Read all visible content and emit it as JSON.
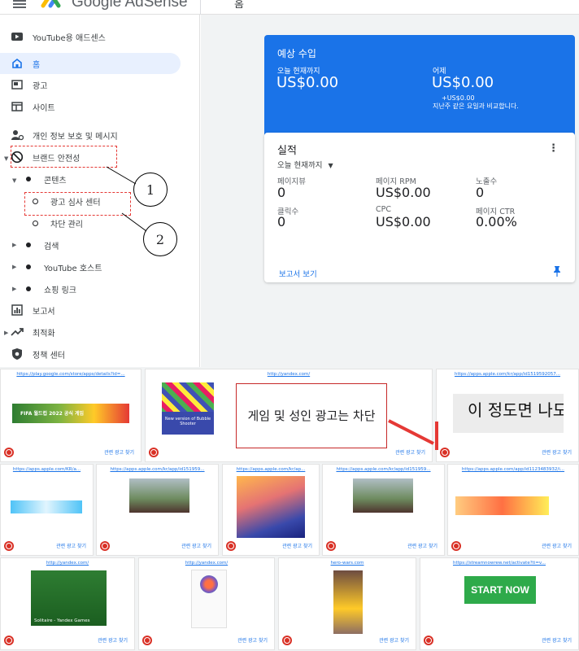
{
  "header": {
    "brand": "Google AdSense",
    "page_title": "홈"
  },
  "sidebar": {
    "items": [
      {
        "label": "YouTube용 애드센스",
        "icon": "youtube-icon"
      },
      {
        "label": "홈",
        "icon": "home-icon",
        "active": true
      },
      {
        "label": "광고",
        "icon": "ads-icon"
      },
      {
        "label": "사이트",
        "icon": "sites-icon"
      },
      {
        "label": "개인 정보 보호 및 메시지",
        "icon": "privacy-icon"
      },
      {
        "label": "브랜드 안전성",
        "icon": "block-icon"
      },
      {
        "label": "콘텐츠",
        "icon": "dot-icon"
      },
      {
        "label": "광고 심사 센터",
        "icon": "ring-icon"
      },
      {
        "label": "차단 관리",
        "icon": "ring-icon"
      },
      {
        "label": "검색",
        "icon": "dot-icon"
      },
      {
        "label": "YouTube 호스트",
        "icon": "dot-icon"
      },
      {
        "label": "쇼핑 링크",
        "icon": "dot-icon"
      },
      {
        "label": "보고서",
        "icon": "reports-icon"
      },
      {
        "label": "최적화",
        "icon": "trend-icon"
      },
      {
        "label": "정책 센터",
        "icon": "policy-icon"
      }
    ]
  },
  "earnings": {
    "title": "예상 수입",
    "today_label": "오늘 현재까지",
    "today_value": "US$0.00",
    "yesterday_label": "어제",
    "yesterday_value": "US$0.00",
    "delta": "+US$0.00",
    "compare_note": "지난주 같은 요일과 비교합니다."
  },
  "performance": {
    "title": "실적",
    "range": "오늘 현재까지",
    "metrics": [
      {
        "label": "페이지뷰",
        "value": "0"
      },
      {
        "label": "페이지 RPM",
        "value": "US$0.00"
      },
      {
        "label": "노출수",
        "value": "0"
      },
      {
        "label": "클릭수",
        "value": "0"
      },
      {
        "label": "CPC",
        "value": "US$0.00"
      },
      {
        "label": "페이지 CTR",
        "value": "0.00%"
      }
    ],
    "report_link": "보고서 보기"
  },
  "callouts": {
    "one": "1",
    "two": "2"
  },
  "annotation_note": "게임 및 성인 광고는 차단",
  "ads": {
    "find_label": "관련 광고 찾기",
    "tiles": [
      {
        "url": "https://play.google.com/store/apps/details?id=...",
        "creative_text": "FIFA 월드컵 2022 공식 게임"
      },
      {
        "url": "http://yandex.com/",
        "creative_text": "New version of Bubble Shooter"
      },
      {
        "url": "https://apps.apple.com/kr/app/id1519592057...",
        "creative_text": "이 정도면 나도"
      },
      {
        "url": "https://apps.apple.com/KR/a...",
        "creative_text": ""
      },
      {
        "url": "https://apps.apple.com/kr/app/id151959...",
        "creative_text": ""
      },
      {
        "url": "https://apps.apple.com/kr/ap...",
        "creative_text": ""
      },
      {
        "url": "https://apps.apple.com/kr/app/id151959...",
        "creative_text": ""
      },
      {
        "url": "https://apps.apple.com/app/id1123483932/i...",
        "creative_text": ""
      },
      {
        "url": "http://yandex.com/",
        "creative_text": "Solitaire - Yandex Games"
      },
      {
        "url": "http://yandex.com/",
        "creative_text": ""
      },
      {
        "url": "hero-wars.com",
        "creative_text": ""
      },
      {
        "url": "https://streamnowrew.net/activate?ti=v...",
        "creative_text": "START NOW"
      }
    ]
  },
  "colors": {
    "accent": "#1a73e8",
    "block_red": "#d93025",
    "annotation_red": "#e53935"
  }
}
